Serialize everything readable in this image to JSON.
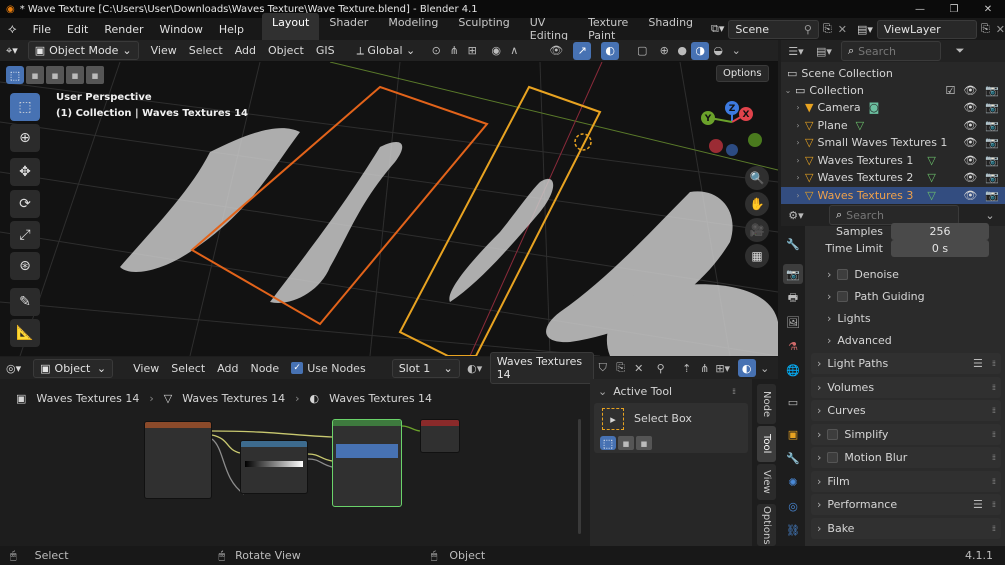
{
  "window": {
    "title": "* Wave Texture [C:\\Users\\User\\Downloads\\Waves Texture\\Wave Texture.blend] - Blender 4.1"
  },
  "menu": [
    "File",
    "Edit",
    "Render",
    "Window",
    "Help"
  ],
  "workspaces": [
    {
      "label": "Layout",
      "active": true
    },
    {
      "label": "Shader"
    },
    {
      "label": "Modeling"
    },
    {
      "label": "Sculpting"
    },
    {
      "label": "UV Editing"
    },
    {
      "label": "Texture Paint"
    },
    {
      "label": "Shading"
    }
  ],
  "scene": {
    "name": "Scene"
  },
  "view_layer": {
    "name": "ViewLayer"
  },
  "viewport_header": {
    "mode": "Object Mode",
    "menus": [
      "View",
      "Select",
      "Add",
      "Object",
      "GIS"
    ],
    "orientation": "Global",
    "options": "Options"
  },
  "viewport": {
    "perspective": "User Perspective",
    "collection_info": "(1) Collection | Waves Textures 14"
  },
  "gizmo": {
    "x": "X",
    "y": "Y",
    "z": "Z"
  },
  "node_header": {
    "type": "Object",
    "menus": [
      "View",
      "Select",
      "Add",
      "Node"
    ],
    "use_nodes": "Use Nodes",
    "slot": "Slot 1",
    "material": "Waves Textures 14"
  },
  "breadcrumb": [
    "Waves Textures 14",
    "Waves Textures 14",
    "Waves Textures 14"
  ],
  "sidebar": {
    "active_tool_title": "Active Tool",
    "tool_name": "Select Box"
  },
  "side_tabs": [
    "Node",
    "Tool",
    "View",
    "Options"
  ],
  "outliner": {
    "search_placeholder": "Search",
    "root": "Scene Collection",
    "collection": "Collection",
    "items": [
      {
        "name": "Camera"
      },
      {
        "name": "Plane"
      },
      {
        "name": "Small Waves Textures 1"
      },
      {
        "name": "Waves Textures 1"
      },
      {
        "name": "Waves Textures 2"
      },
      {
        "name": "Waves Textures 3",
        "selected": true
      }
    ]
  },
  "properties": {
    "search_placeholder": "Search",
    "samples_label": "Samples",
    "samples_value": "256",
    "time_limit_label": "Time Limit",
    "time_limit_value": "0 s",
    "subpanels": [
      "Denoise",
      "Path Guiding",
      "Lights",
      "Advanced"
    ],
    "panels": [
      {
        "label": "Light Paths",
        "list": true
      },
      {
        "label": "Volumes"
      },
      {
        "label": "Curves"
      },
      {
        "label": "Simplify",
        "check": true
      },
      {
        "label": "Motion Blur",
        "check": true
      },
      {
        "label": "Film"
      },
      {
        "label": "Performance",
        "list": true
      },
      {
        "label": "Bake"
      }
    ]
  },
  "status": {
    "left": "Select",
    "middle": "Rotate View",
    "right": "Object",
    "version": "4.1.1"
  }
}
